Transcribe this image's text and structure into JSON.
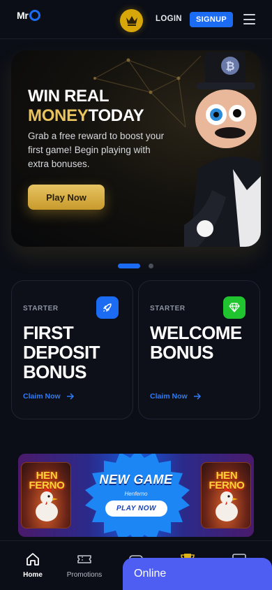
{
  "header": {
    "logo_text": "Mr",
    "login_label": "LOGIN",
    "signup_label": "SIGNUP"
  },
  "hero": {
    "title_line1": "WIN REAL",
    "title_gold": "MONEY",
    "title_rest": "TODAY",
    "description": "Grab a free reward to boost your first game! Begin playing with extra bonuses.",
    "button_label": "Play Now",
    "carousel_index": 1,
    "carousel_count": 2
  },
  "cards": [
    {
      "tag": "STARTER",
      "title": "FIRST\nDEPOSIT\nBONUS",
      "link": "Claim Now",
      "icon": "rocket-icon",
      "icon_color": "#1b6cf2"
    },
    {
      "tag": "STARTER",
      "title": "WELCOME\nBONUS",
      "link": "Claim Now",
      "icon": "diamond-icon",
      "icon_color": "#1fc42e"
    }
  ],
  "banner": {
    "title": "NEW GAME",
    "subtitle": "Henferno",
    "button_label": "PLAY NOW",
    "game_logo": "HEN\nFERNO"
  },
  "bottom_nav": [
    {
      "label": "Home",
      "icon": "home-icon",
      "active": true
    },
    {
      "label": "Promotions",
      "icon": "ticket-icon",
      "active": false
    },
    {
      "label": "",
      "icon": "gamepad-icon",
      "active": false
    },
    {
      "label": "",
      "icon": "trophy-icon",
      "active": false
    },
    {
      "label": "",
      "icon": "chat-icon",
      "active": false
    }
  ],
  "chat_widget": {
    "label": "Online"
  },
  "colors": {
    "accent": "#1b6cf2",
    "gold": "#e9c35e",
    "background": "#0b0e16",
    "online": "#4f5ef2"
  }
}
